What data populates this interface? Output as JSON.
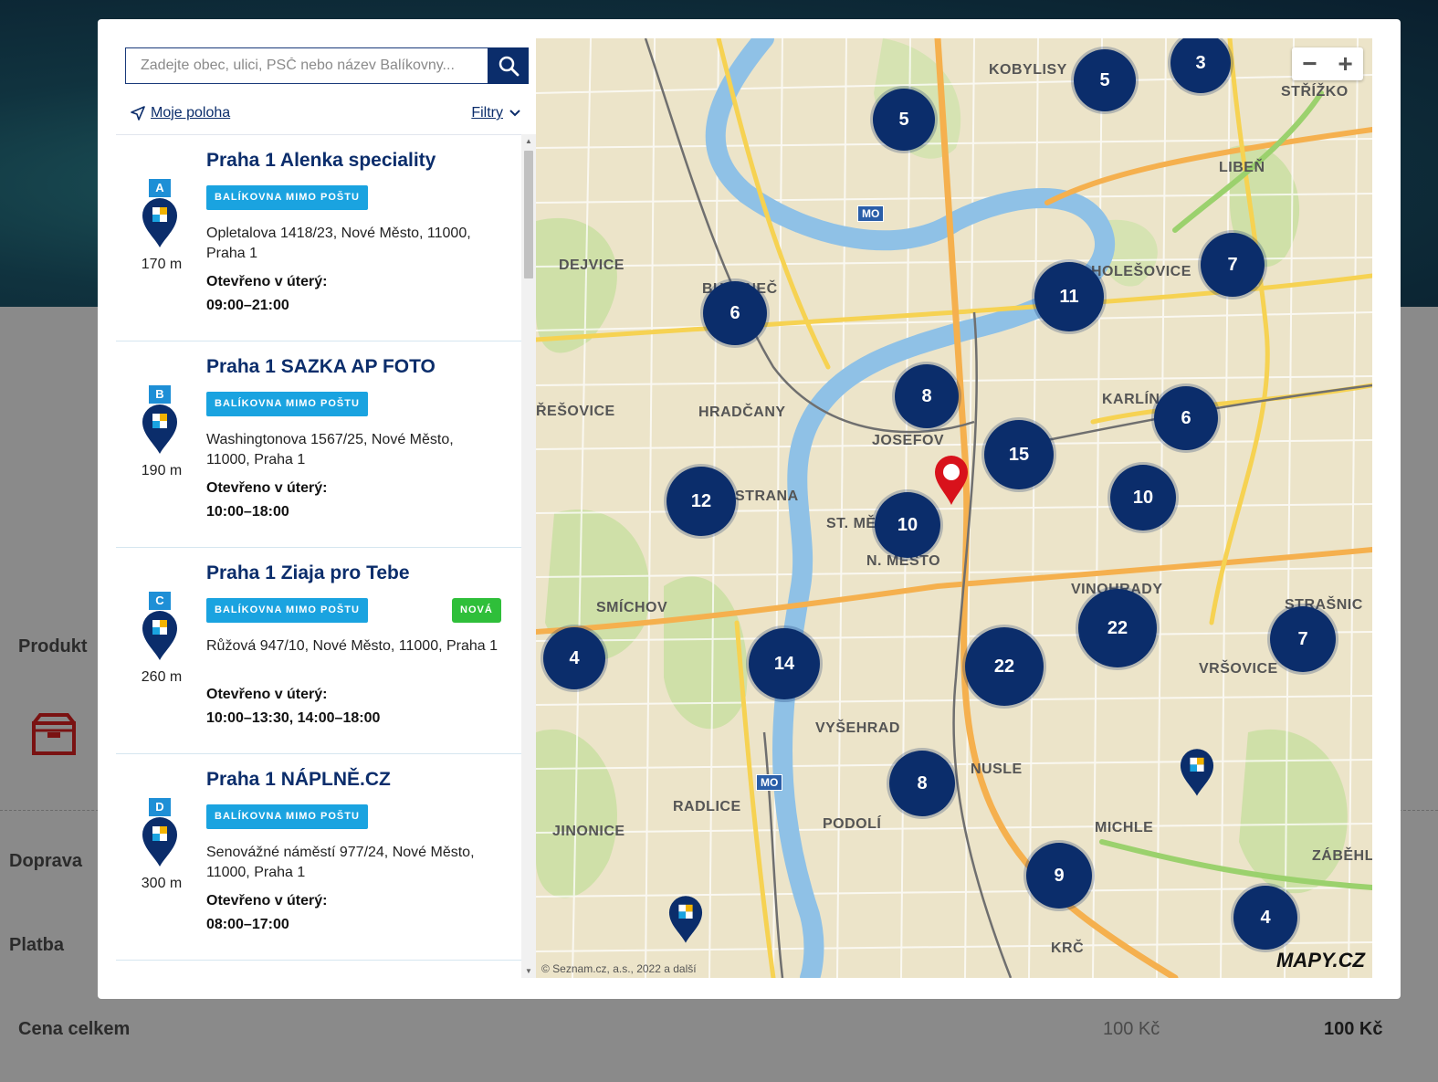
{
  "background": {
    "labels": {
      "produkt": "Produkt",
      "doprava": "Doprava",
      "platba": "Platba",
      "cena_celkem": "Cena celkem"
    },
    "prices": {
      "unit": "100 Kč",
      "total": "100 Kč"
    }
  },
  "search": {
    "placeholder": "Zadejte obec, ulici, PSČ nebo název Balíkovny..."
  },
  "toolbar": {
    "my_location": "Moje poloha",
    "filters": "Filtry"
  },
  "locations": [
    {
      "letter": "A",
      "distance": "170 m",
      "title": "Praha 1 Alenka speciality",
      "badge": "BALÍKOVNA MIMO POŠTU",
      "address": "Opletalova 1418/23, Nové Město, 11000, Praha 1",
      "hours_label": "Otevřeno v úterý:",
      "hours": "09:00–21:00"
    },
    {
      "letter": "B",
      "distance": "190 m",
      "title": "Praha 1 SAZKA AP FOTO",
      "badge": "BALÍKOVNA MIMO POŠTU",
      "address": "Washingtonova 1567/25, Nové Město, 11000, Praha 1",
      "hours_label": "Otevřeno v úterý:",
      "hours": "10:00–18:00"
    },
    {
      "letter": "C",
      "distance": "260 m",
      "title": "Praha 1 Ziaja pro Tebe",
      "badge": "BALÍKOVNA MIMO POŠTU",
      "badge_new": "NOVÁ",
      "address": "Růžová 947/10, Nové Město, 11000, Praha 1",
      "hours_label": "Otevřeno v úterý:",
      "hours": "10:00–13:30, 14:00–18:00"
    },
    {
      "letter": "D",
      "distance": "300 m",
      "title": "Praha 1 NÁPLNĚ.CZ",
      "badge": "BALÍKOVNA MIMO POŠTU",
      "address": "Senovážné náměstí 977/24, Nové Město, 11000, Praha 1",
      "hours_label": "Otevřeno v úterý:",
      "hours": "08:00–17:00"
    }
  ],
  "map": {
    "districts": [
      "KOBYLISY",
      "STŘÍŽKO",
      "LIBEŇ",
      "DEJVICE",
      "BUBENEČ",
      "HRADČANY",
      "KARLÍN",
      "JOSEFOV",
      "STRANA",
      "ST. MĚ",
      "N. MĚSTO",
      "VINOHRADY",
      "SMÍCHOV",
      "STRAŠNIC",
      "VRŠOVICE",
      "VYŠEHRAD",
      "NUSLE",
      "RADLICE",
      "PODOLÍ",
      "JINONICE",
      "MICHLE",
      "ZÁBĚHLI",
      "KRČ",
      "ŘEŠOVICE",
      "HOLEŠOVICE"
    ],
    "clusters": [
      "5",
      "3",
      "5",
      "7",
      "11",
      "6",
      "8",
      "6",
      "15",
      "10",
      "12",
      "10",
      "22",
      "22",
      "4",
      "14",
      "7",
      "8",
      "9",
      "4"
    ],
    "zoom_out": "−",
    "zoom_in": "+",
    "copyright": "© Seznam.cz, a.s., 2022 a další",
    "logo": "MAPY.CZ",
    "metro_tag": "MO"
  },
  "colors": {
    "brand_navy": "#0b2d6b",
    "badge_blue": "#1aa3e0",
    "badge_green": "#2fbf3a",
    "pin_red": "#d8121b"
  }
}
